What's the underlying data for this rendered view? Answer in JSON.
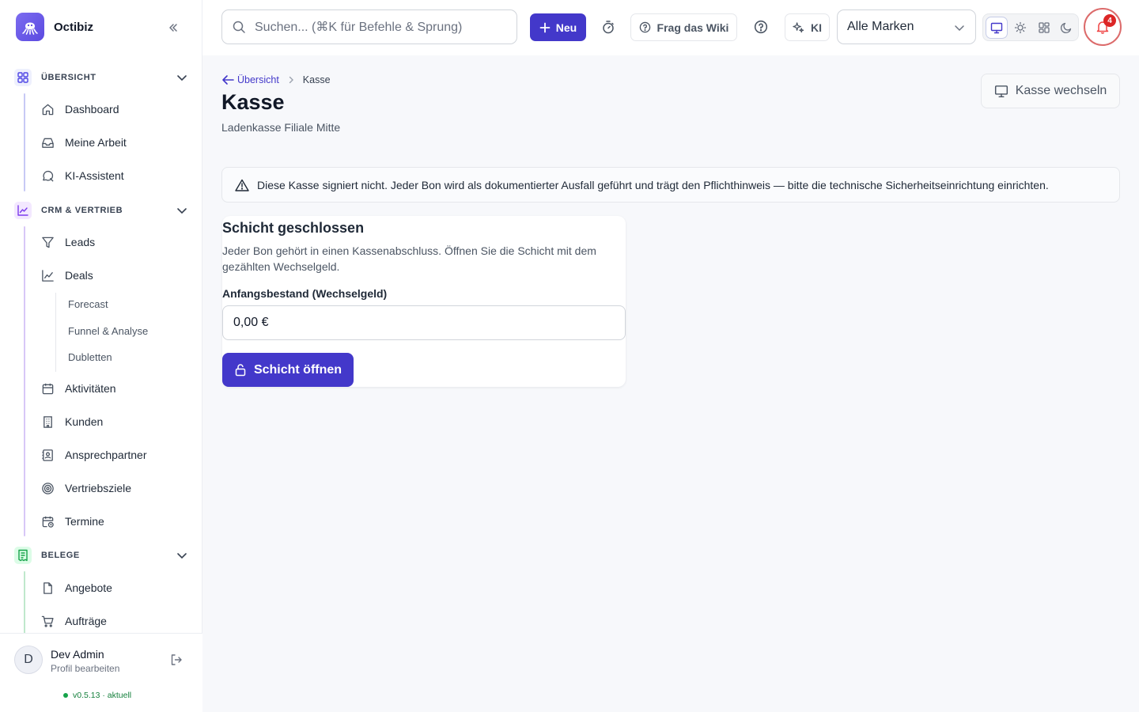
{
  "app": {
    "name": "Octibiz"
  },
  "sidebar": {
    "sections": [
      {
        "label": "ÜBERSICHT",
        "items": [
          {
            "label": "Dashboard",
            "icon": "home-icon"
          },
          {
            "label": "Meine Arbeit",
            "icon": "inbox-icon"
          },
          {
            "label": "KI-Assistent",
            "icon": "chat-icon"
          }
        ]
      },
      {
        "label": "CRM & VERTRIEB",
        "items": [
          {
            "label": "Leads",
            "icon": "filter-icon"
          },
          {
            "label": "Deals",
            "icon": "chart-icon",
            "subitems": [
              "Forecast",
              "Funnel & Analyse",
              "Dubletten"
            ]
          },
          {
            "label": "Aktivitäten",
            "icon": "calendar-icon"
          },
          {
            "label": "Kunden",
            "icon": "building-icon"
          },
          {
            "label": "Ansprechpartner",
            "icon": "contact-icon"
          },
          {
            "label": "Vertriebsziele",
            "icon": "target-icon"
          },
          {
            "label": "Termine",
            "icon": "calendar-clock-icon"
          }
        ]
      },
      {
        "label": "BELEGE",
        "items": [
          {
            "label": "Angebote",
            "icon": "file-icon"
          },
          {
            "label": "Aufträge",
            "icon": "cart-icon"
          }
        ]
      }
    ],
    "user": {
      "initial": "D",
      "name": "Dev Admin",
      "sub": "Profil bearbeiten"
    },
    "version": {
      "text": "v0.5.13 · aktuell"
    }
  },
  "topbar": {
    "search_placeholder": "Suchen... (⌘K für Befehle & Sprung)",
    "new_label": "Neu",
    "wiki_label": "Frag das Wiki",
    "ai_label": "KI",
    "brand_select": "Alle Marken",
    "notifications": "4"
  },
  "breadcrumb": {
    "back": "Übersicht",
    "current": "Kasse"
  },
  "page": {
    "title": "Kasse",
    "subtitle": "Ladenkasse Filiale Mitte",
    "switch_label": "Kasse wechseln"
  },
  "alert": {
    "text": "Diese Kasse signiert nicht. Jeder Bon wird als dokumentierter Ausfall geführt und trägt den Pflichthinweis — bitte die technische Sicherheitseinrichtung einrichten."
  },
  "shift_card": {
    "title": "Schicht geschlossen",
    "description": "Jeder Bon gehört in einen Kassenabschluss. Öffnen Sie die Schicht mit dem gezählten Wechselgeld.",
    "field_label": "Anfangsbestand (Wechselgeld)",
    "field_value": "0,00 €",
    "button_label": "Schicht öffnen"
  },
  "colors": {
    "accent": "#4338ca",
    "alert_badge": "#dc2626",
    "version_ok": "#16a34a"
  }
}
